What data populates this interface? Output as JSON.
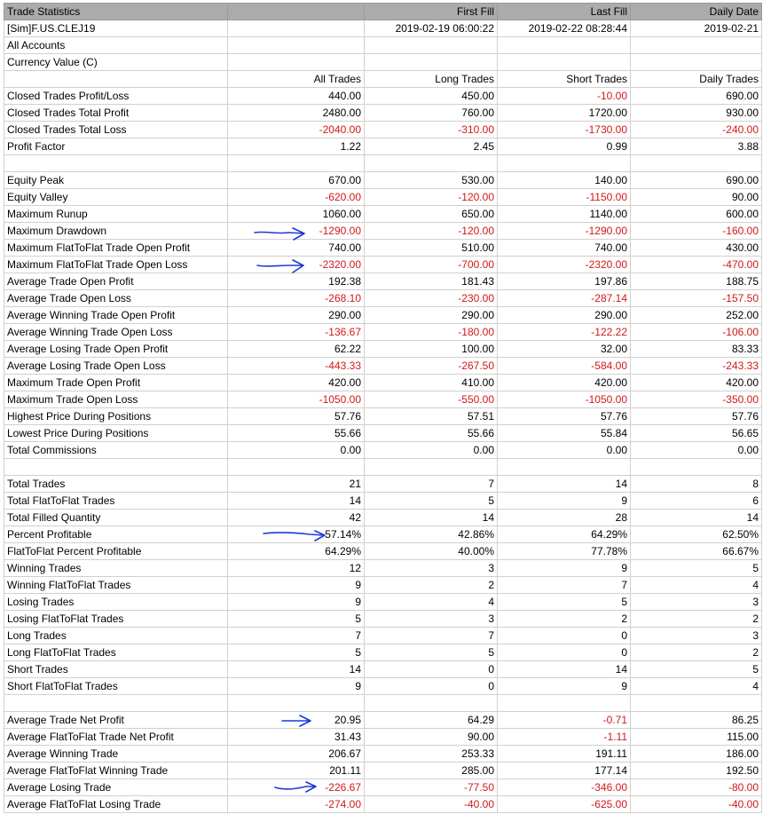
{
  "header": {
    "cells": [
      "Trade Statistics",
      "",
      "First Fill",
      "Last Fill",
      "Daily Date"
    ]
  },
  "info_rows": [
    [
      "[Sim]F.US.CLEJ19",
      "",
      "2019-02-19  06:00:22",
      "2019-02-22  08:28:44",
      "2019-02-21"
    ],
    [
      "All Accounts",
      "",
      "",
      "",
      ""
    ],
    [
      "Currency Value (C)",
      "",
      "",
      "",
      ""
    ]
  ],
  "column_headers": [
    "",
    "All Trades",
    "Long Trades",
    "Short Trades",
    "Daily Trades"
  ],
  "sections": [
    [
      [
        "Closed Trades Profit/Loss",
        "440.00",
        "450.00",
        "-10.00",
        "690.00"
      ],
      [
        "Closed Trades Total Profit",
        "2480.00",
        "760.00",
        "1720.00",
        "930.00"
      ],
      [
        "Closed Trades Total Loss",
        "-2040.00",
        "-310.00",
        "-1730.00",
        "-240.00"
      ],
      [
        "Profit Factor",
        "1.22",
        "2.45",
        "0.99",
        "3.88"
      ]
    ],
    [
      [
        "Equity Peak",
        "670.00",
        "530.00",
        "140.00",
        "690.00"
      ],
      [
        "Equity Valley",
        "-620.00",
        "-120.00",
        "-1150.00",
        "90.00"
      ],
      [
        "Maximum Runup",
        "1060.00",
        "650.00",
        "1140.00",
        "600.00"
      ],
      [
        "Maximum Drawdown",
        "-1290.00",
        "-120.00",
        "-1290.00",
        "-160.00"
      ],
      [
        "Maximum FlatToFlat Trade Open Profit",
        "740.00",
        "510.00",
        "740.00",
        "430.00"
      ],
      [
        "Maximum FlatToFlat Trade Open Loss",
        "-2320.00",
        "-700.00",
        "-2320.00",
        "-470.00"
      ],
      [
        "Average Trade Open Profit",
        "192.38",
        "181.43",
        "197.86",
        "188.75"
      ],
      [
        "Average Trade Open Loss",
        "-268.10",
        "-230.00",
        "-287.14",
        "-157.50"
      ],
      [
        "Average Winning Trade Open Profit",
        "290.00",
        "290.00",
        "290.00",
        "252.00"
      ],
      [
        "Average Winning Trade Open Loss",
        "-136.67",
        "-180.00",
        "-122.22",
        "-106.00"
      ],
      [
        "Average Losing Trade Open Profit",
        "62.22",
        "100.00",
        "32.00",
        "83.33"
      ],
      [
        "Average Losing Trade Open Loss",
        "-443.33",
        "-267.50",
        "-584.00",
        "-243.33"
      ],
      [
        "Maximum Trade Open Profit",
        "420.00",
        "410.00",
        "420.00",
        "420.00"
      ],
      [
        "Maximum Trade Open Loss",
        "-1050.00",
        "-550.00",
        "-1050.00",
        "-350.00"
      ],
      [
        "Highest Price During Positions",
        "57.76",
        "57.51",
        "57.76",
        "57.76"
      ],
      [
        "Lowest Price During Positions",
        "55.66",
        "55.66",
        "55.84",
        "56.65"
      ],
      [
        "Total Commissions",
        "0.00",
        "0.00",
        "0.00",
        "0.00"
      ]
    ],
    [
      [
        "Total Trades",
        "21",
        "7",
        "14",
        "8"
      ],
      [
        "Total FlatToFlat Trades",
        "14",
        "5",
        "9",
        "6"
      ],
      [
        "Total Filled Quantity",
        "42",
        "14",
        "28",
        "14"
      ],
      [
        "Percent Profitable",
        "57.14%",
        "42.86%",
        "64.29%",
        "62.50%"
      ],
      [
        "FlatToFlat Percent Profitable",
        "64.29%",
        "40.00%",
        "77.78%",
        "66.67%"
      ],
      [
        "Winning Trades",
        "12",
        "3",
        "9",
        "5"
      ],
      [
        "Winning FlatToFlat Trades",
        "9",
        "2",
        "7",
        "4"
      ],
      [
        "Losing Trades",
        "9",
        "4",
        "5",
        "3"
      ],
      [
        "Losing FlatToFlat Trades",
        "5",
        "3",
        "2",
        "2"
      ],
      [
        "Long Trades",
        "7",
        "7",
        "0",
        "3"
      ],
      [
        "Long FlatToFlat Trades",
        "5",
        "5",
        "0",
        "2"
      ],
      [
        "Short Trades",
        "14",
        "0",
        "14",
        "5"
      ],
      [
        "Short FlatToFlat Trades",
        "9",
        "0",
        "9",
        "4"
      ]
    ],
    [
      [
        "Average Trade Net Profit",
        "20.95",
        "64.29",
        "-0.71",
        "86.25"
      ],
      [
        "Average FlatToFlat Trade Net Profit",
        "31.43",
        "90.00",
        "-1.11",
        "115.00"
      ],
      [
        "Average Winning Trade",
        "206.67",
        "253.33",
        "191.11",
        "186.00"
      ],
      [
        "Average FlatToFlat Winning Trade",
        "201.11",
        "285.00",
        "177.14",
        "192.50"
      ],
      [
        "Average Losing Trade",
        "-226.67",
        "-77.50",
        "-346.00",
        "-80.00"
      ],
      [
        "Average FlatToFlat Losing Trade",
        "-274.00",
        "-40.00",
        "-625.00",
        "-40.00"
      ]
    ]
  ],
  "colors": {
    "header_bg": "#ababab",
    "negative": "#d01818",
    "grid": "#d0d0d0",
    "annotation": "#1a3ad8"
  }
}
